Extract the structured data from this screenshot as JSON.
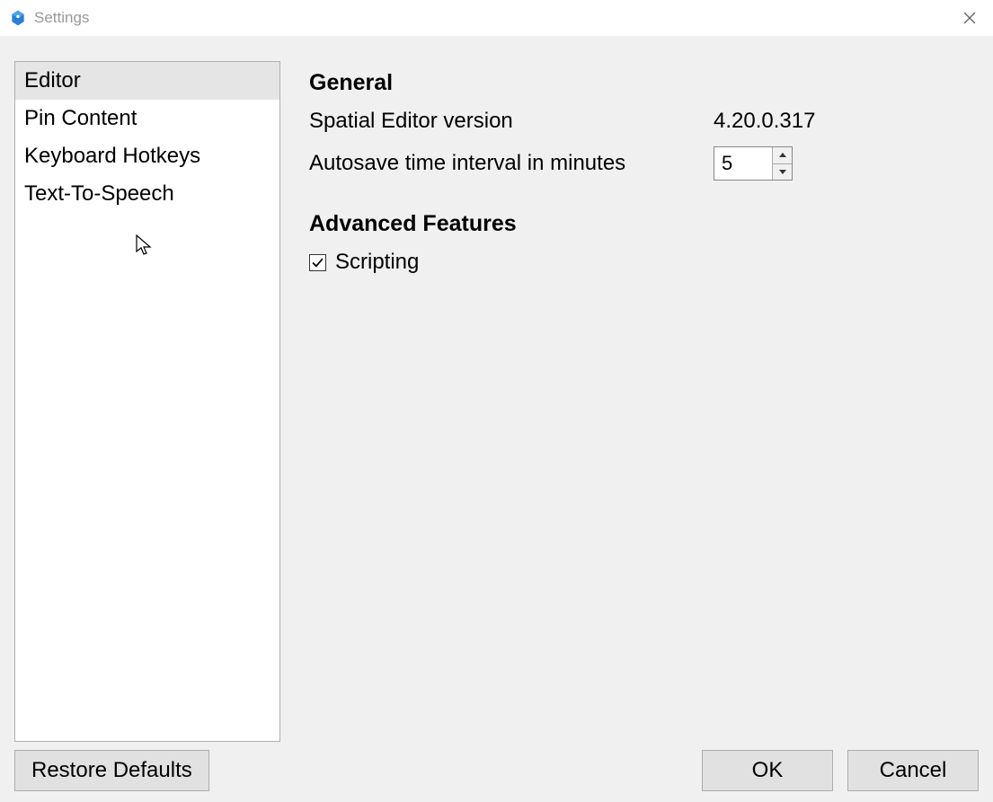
{
  "window": {
    "title": "Settings"
  },
  "sidebar": {
    "items": [
      {
        "label": "Editor",
        "selected": true
      },
      {
        "label": "Pin Content",
        "selected": false
      },
      {
        "label": "Keyboard Hotkeys",
        "selected": false
      },
      {
        "label": "Text-To-Speech",
        "selected": false
      }
    ]
  },
  "sections": {
    "general": {
      "title": "General",
      "version_label": "Spatial Editor version",
      "version_value": "4.20.0.317",
      "autosave_label": "Autosave time interval in minutes",
      "autosave_value": "5"
    },
    "advanced": {
      "title": "Advanced Features",
      "scripting_label": "Scripting",
      "scripting_checked": true
    }
  },
  "buttons": {
    "restore": "Restore Defaults",
    "ok": "OK",
    "cancel": "Cancel"
  }
}
